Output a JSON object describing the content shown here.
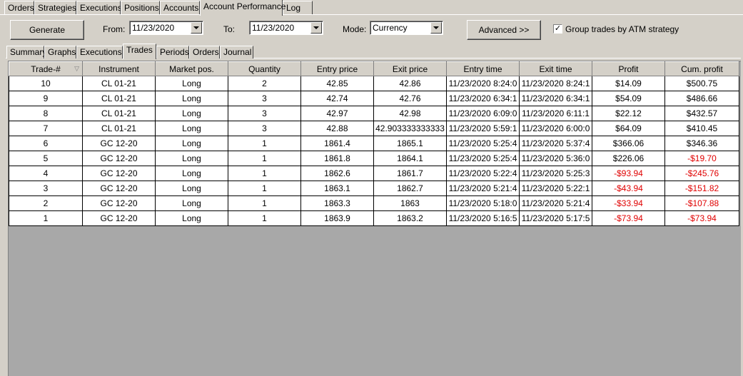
{
  "top_tabs": [
    {
      "label": "Orders"
    },
    {
      "label": "Strategies"
    },
    {
      "label": "Executions"
    },
    {
      "label": "Positions"
    },
    {
      "label": "Accounts"
    },
    {
      "label": "Account Performance"
    },
    {
      "label": "Log"
    }
  ],
  "toolbar": {
    "generate_label": "Generate",
    "from_label": "From:",
    "from_value": "11/23/2020",
    "to_label": "To:",
    "to_value": "11/23/2020",
    "mode_label": "Mode:",
    "mode_value": "Currency",
    "advanced_label": "Advanced >>",
    "group_label": "Group trades by ATM strategy",
    "group_checked": "✓"
  },
  "sub_tabs": [
    {
      "label": "Summary"
    },
    {
      "label": "Graphs"
    },
    {
      "label": "Executions"
    },
    {
      "label": "Trades"
    },
    {
      "label": "Periods"
    },
    {
      "label": "Orders"
    },
    {
      "label": "Journal"
    }
  ],
  "columns": [
    "Trade-#",
    "Instrument",
    "Market pos.",
    "Quantity",
    "Entry price",
    "Exit price",
    "Entry time",
    "Exit time",
    "Profit",
    "Cum. profit"
  ],
  "rows": [
    [
      "10",
      "CL 01-21",
      "Long",
      "2",
      "42.85",
      "42.86",
      "11/23/2020 8:24:0",
      "11/23/2020 8:24:1",
      "$14.09",
      "$500.75"
    ],
    [
      "9",
      "CL 01-21",
      "Long",
      "3",
      "42.74",
      "42.76",
      "11/23/2020 6:34:1",
      "11/23/2020 6:34:1",
      "$54.09",
      "$486.66"
    ],
    [
      "8",
      "CL 01-21",
      "Long",
      "3",
      "42.97",
      "42.98",
      "11/23/2020 6:09:0",
      "11/23/2020 6:11:1",
      "$22.12",
      "$432.57"
    ],
    [
      "7",
      "CL 01-21",
      "Long",
      "3",
      "42.88",
      "42.903333333333",
      "11/23/2020 5:59:1",
      "11/23/2020 6:00:0",
      "$64.09",
      "$410.45"
    ],
    [
      "6",
      "GC 12-20",
      "Long",
      "1",
      "1861.4",
      "1865.1",
      "11/23/2020 5:25:4",
      "11/23/2020 5:37:4",
      "$366.06",
      "$346.36"
    ],
    [
      "5",
      "GC 12-20",
      "Long",
      "1",
      "1861.8",
      "1864.1",
      "11/23/2020 5:25:4",
      "11/23/2020 5:36:0",
      "$226.06",
      "-$19.70"
    ],
    [
      "4",
      "GC 12-20",
      "Long",
      "1",
      "1862.6",
      "1861.7",
      "11/23/2020 5:22:4",
      "11/23/2020 5:25:3",
      "-$93.94",
      "-$245.76"
    ],
    [
      "3",
      "GC 12-20",
      "Long",
      "1",
      "1863.1",
      "1862.7",
      "11/23/2020 5:21:4",
      "11/23/2020 5:22:1",
      "-$43.94",
      "-$151.82"
    ],
    [
      "2",
      "GC 12-20",
      "Long",
      "1",
      "1863.3",
      "1863",
      "11/23/2020 5:18:0",
      "11/23/2020 5:21:4",
      "-$33.94",
      "-$107.88"
    ],
    [
      "1",
      "GC 12-20",
      "Long",
      "1",
      "1863.9",
      "1863.2",
      "11/23/2020 5:16:5",
      "11/23/2020 5:17:5",
      "-$73.94",
      "-$73.94"
    ]
  ],
  "colors": {
    "negative": "#e00000",
    "background": "#d4d0c8",
    "grid_empty": "#a8a8a8"
  },
  "icons": {
    "sort": "sort-descending-icon",
    "dropdown": "chevron-down-icon",
    "checkbox": "checkmark-icon"
  }
}
